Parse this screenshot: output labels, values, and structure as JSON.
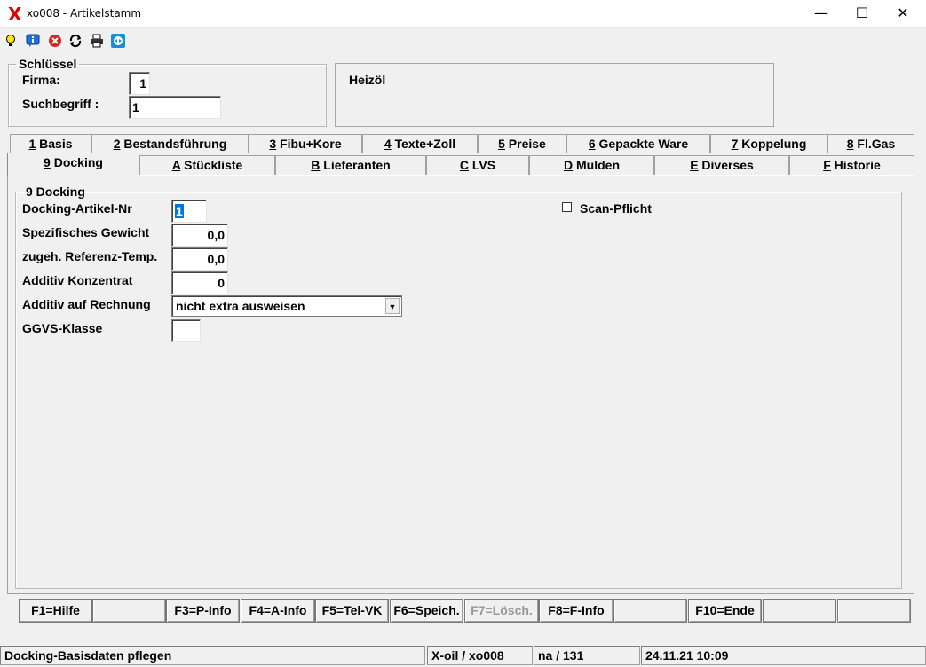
{
  "window": {
    "title": "xo008 - Artikelstamm",
    "app_icon": "X",
    "minimize": "—",
    "maximize": "☐",
    "close": "✕"
  },
  "toolbar": {
    "icons": [
      "lightbulb-icon",
      "info-icon",
      "cancel-icon",
      "refresh-icon",
      "print-icon",
      "teamviewer-icon"
    ]
  },
  "key_group": {
    "legend": "Schlüssel",
    "firma_label": "Firma:",
    "firma_value": "1",
    "suchbegriff_label": "Suchbegriff :",
    "suchbegriff_value": "1"
  },
  "info_panel": {
    "text": "Heizöl"
  },
  "tabs_row1": [
    {
      "key": "1",
      "label": " Basis"
    },
    {
      "key": "2",
      "label": " Bestandsführung"
    },
    {
      "key": "3",
      "label": " Fibu+Kore"
    },
    {
      "key": "4",
      "label": " Texte+Zoll"
    },
    {
      "key": "5",
      "label": " Preise"
    },
    {
      "key": "6",
      "label": " Gepackte Ware"
    },
    {
      "key": "7",
      "label": " Koppelung"
    },
    {
      "key": "8",
      "label": " Fl.Gas"
    }
  ],
  "tabs_row2": [
    {
      "key": "9",
      "label": " Docking"
    },
    {
      "key": "A",
      "label": " Stückliste"
    },
    {
      "key": "B",
      "label": " Lieferanten"
    },
    {
      "key": "C",
      "label": " LVS"
    },
    {
      "key": "D",
      "label": " Mulden"
    },
    {
      "key": "E",
      "label": " Diverses"
    },
    {
      "key": "F",
      "label": " Historie"
    }
  ],
  "docking": {
    "legend": "9 Docking",
    "artikel_nr_label": "Docking-Artikel-Nr",
    "artikel_nr_value": "1",
    "gewicht_label": "Spezifisches Gewicht",
    "gewicht_value": "0,0",
    "temp_label": "zugeh. Referenz-Temp.",
    "temp_value": "0,0",
    "konzentrat_label": "Additiv Konzentrat",
    "konzentrat_value": "0",
    "rechnung_label": "Additiv auf Rechnung",
    "rechnung_value": "nicht extra ausweisen",
    "ggvs_label": "GGVS-Klasse",
    "ggvs_value": "",
    "scan_label": "Scan-Pflicht",
    "scan_checked": false
  },
  "function_keys": [
    {
      "label": "F1=Hilfe",
      "enabled": true
    },
    {
      "label": "",
      "enabled": true
    },
    {
      "label": "F3=P-Info",
      "enabled": true
    },
    {
      "label": "F4=A-Info",
      "enabled": true
    },
    {
      "label": "F5=Tel-VK",
      "enabled": true
    },
    {
      "label": "F6=Speich.",
      "enabled": true
    },
    {
      "label": "F7=Lösch.",
      "enabled": false
    },
    {
      "label": "F8=F-Info",
      "enabled": true
    },
    {
      "label": "",
      "enabled": true
    },
    {
      "label": "F10=Ende",
      "enabled": true
    },
    {
      "label": "",
      "enabled": true
    },
    {
      "label": "",
      "enabled": true
    }
  ],
  "status_bar": {
    "message": "Docking-Basisdaten pflegen",
    "program": "X-oil / xo008",
    "user": "na / 131",
    "datetime": "24.11.21 10:09"
  }
}
